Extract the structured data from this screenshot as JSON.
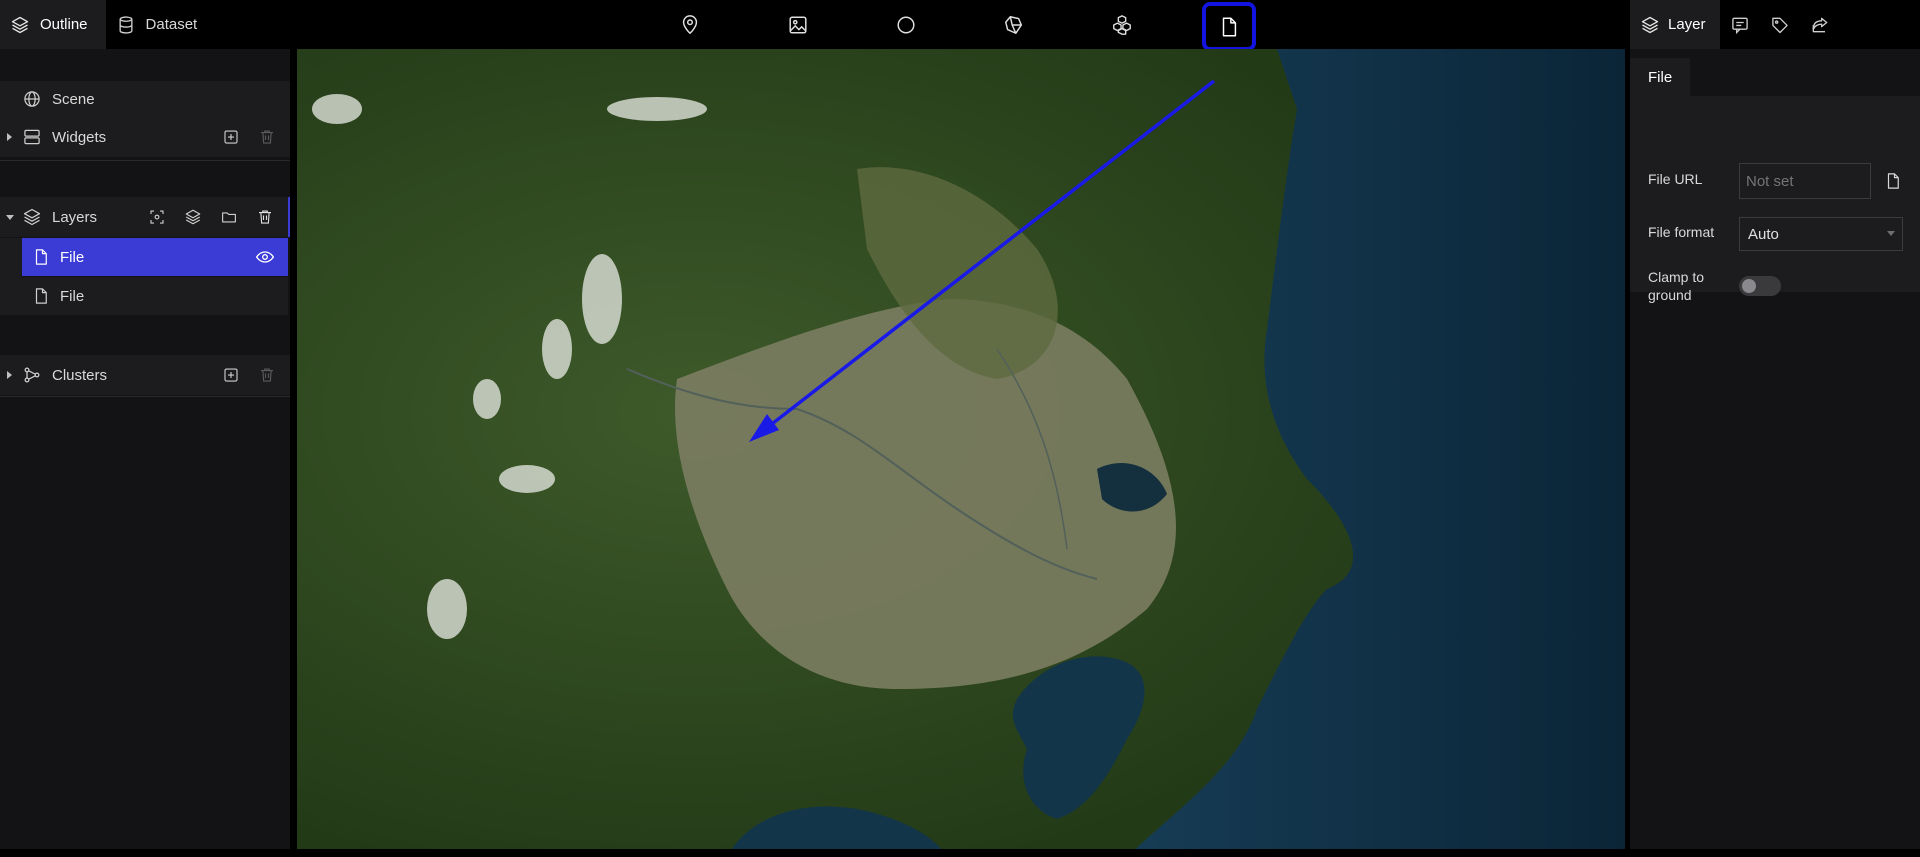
{
  "left_tabs": [
    {
      "label": "Outline",
      "icon": "layers-icon",
      "active": true
    },
    {
      "label": "Dataset",
      "icon": "database-icon",
      "active": false
    }
  ],
  "toolbar": {
    "tools": [
      {
        "name": "marker",
        "icon": "map-pin-icon"
      },
      {
        "name": "photo-overlay",
        "icon": "image-icon"
      },
      {
        "name": "sphere",
        "icon": "circle-icon"
      },
      {
        "name": "polygon-3d",
        "icon": "box-3d-icon"
      },
      {
        "name": "cluster-3d",
        "icon": "cubes-icon"
      },
      {
        "name": "file",
        "icon": "file-icon",
        "highlighted": true
      }
    ]
  },
  "right_tabs": [
    {
      "label": "Layer",
      "icon": "layers-icon",
      "active": true
    },
    {
      "label": "",
      "icon": "comment-icon"
    },
    {
      "label": "",
      "icon": "tag-icon"
    },
    {
      "label": "",
      "icon": "export-icon"
    }
  ],
  "outline": {
    "scene_label": "Scene",
    "widgets_label": "Widgets",
    "layers_label": "Layers",
    "layers": [
      {
        "label": "File",
        "selected": true
      },
      {
        "label": "File",
        "selected": false
      }
    ],
    "clusters_label": "Clusters"
  },
  "inspector": {
    "subtab": "File",
    "file_url_label": "File URL",
    "file_url_placeholder": "Not set",
    "file_format_label": "File format",
    "file_format_value": "Auto",
    "clamp_label": "Clamp to ground",
    "clamp_on": false
  },
  "colors": {
    "accent": "#3b3bd6",
    "highlight_box": "#1414e0",
    "arrow": "#1a1ae6",
    "panel_bg": "#131315",
    "row_bg": "#1c1c1e"
  }
}
